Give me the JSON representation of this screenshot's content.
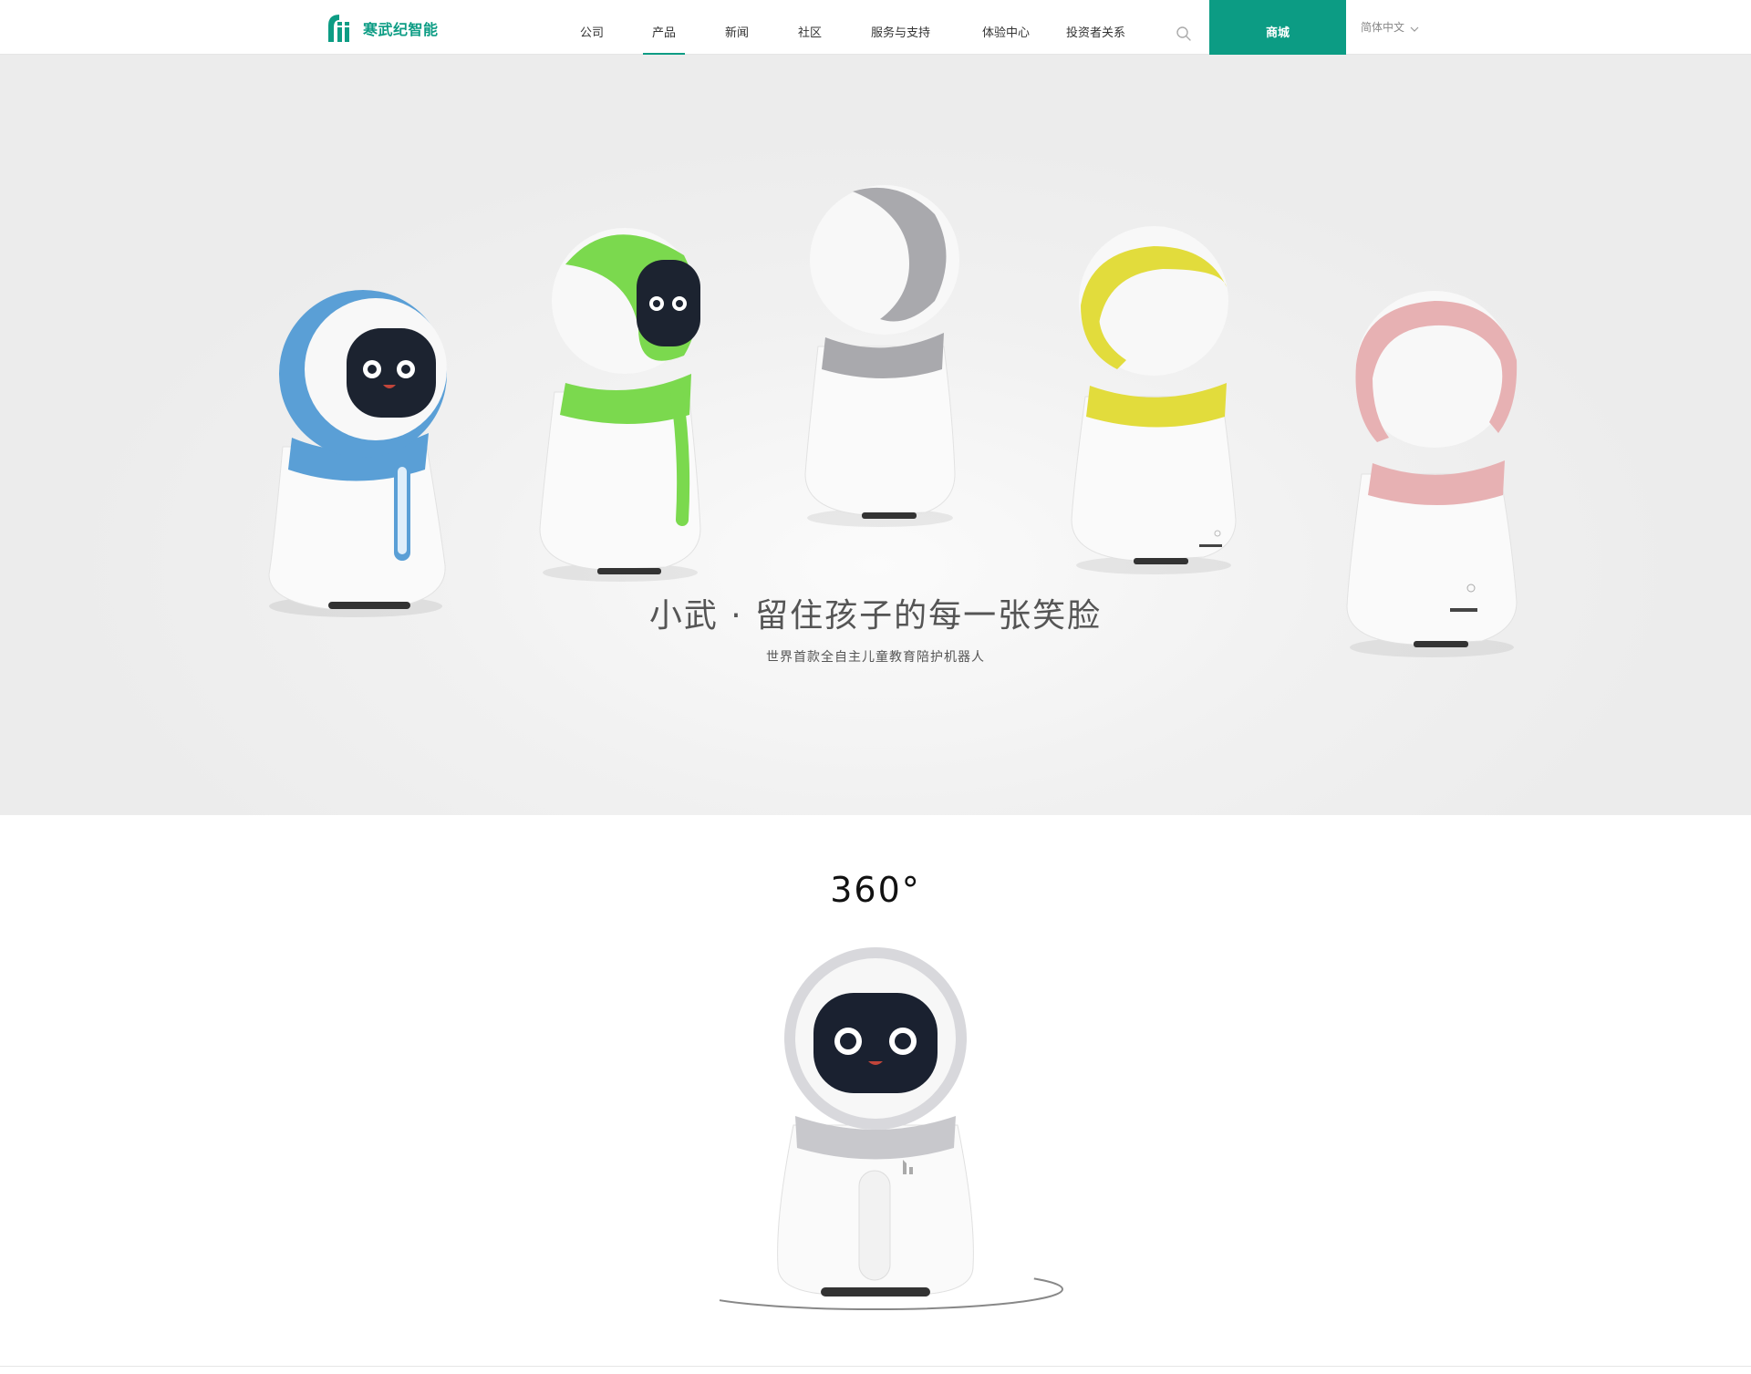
{
  "header": {
    "logo_text": "寒武纪智能",
    "nav": [
      {
        "label": "公司"
      },
      {
        "label": "产品"
      },
      {
        "label": "新闻"
      },
      {
        "label": "社区"
      },
      {
        "label": "服务与支持"
      },
      {
        "label": "体验中心"
      },
      {
        "label": "投资者关系"
      }
    ],
    "active_nav": "产品",
    "search_icon": "search-icon",
    "shop_label": "商城",
    "language": "简体中文",
    "accent_color": "#0c9c84"
  },
  "hero": {
    "title": "小武 · 留住孩子的每一张笑脸",
    "subtitle": "世界首款全自主儿童教育陪护机器人",
    "robot_colors": [
      "#5a9fd6",
      "#7bd94e",
      "#a9a9ad",
      "#e2dc3c",
      "#e7b1b3"
    ]
  },
  "section_360": {
    "title": "360°"
  }
}
